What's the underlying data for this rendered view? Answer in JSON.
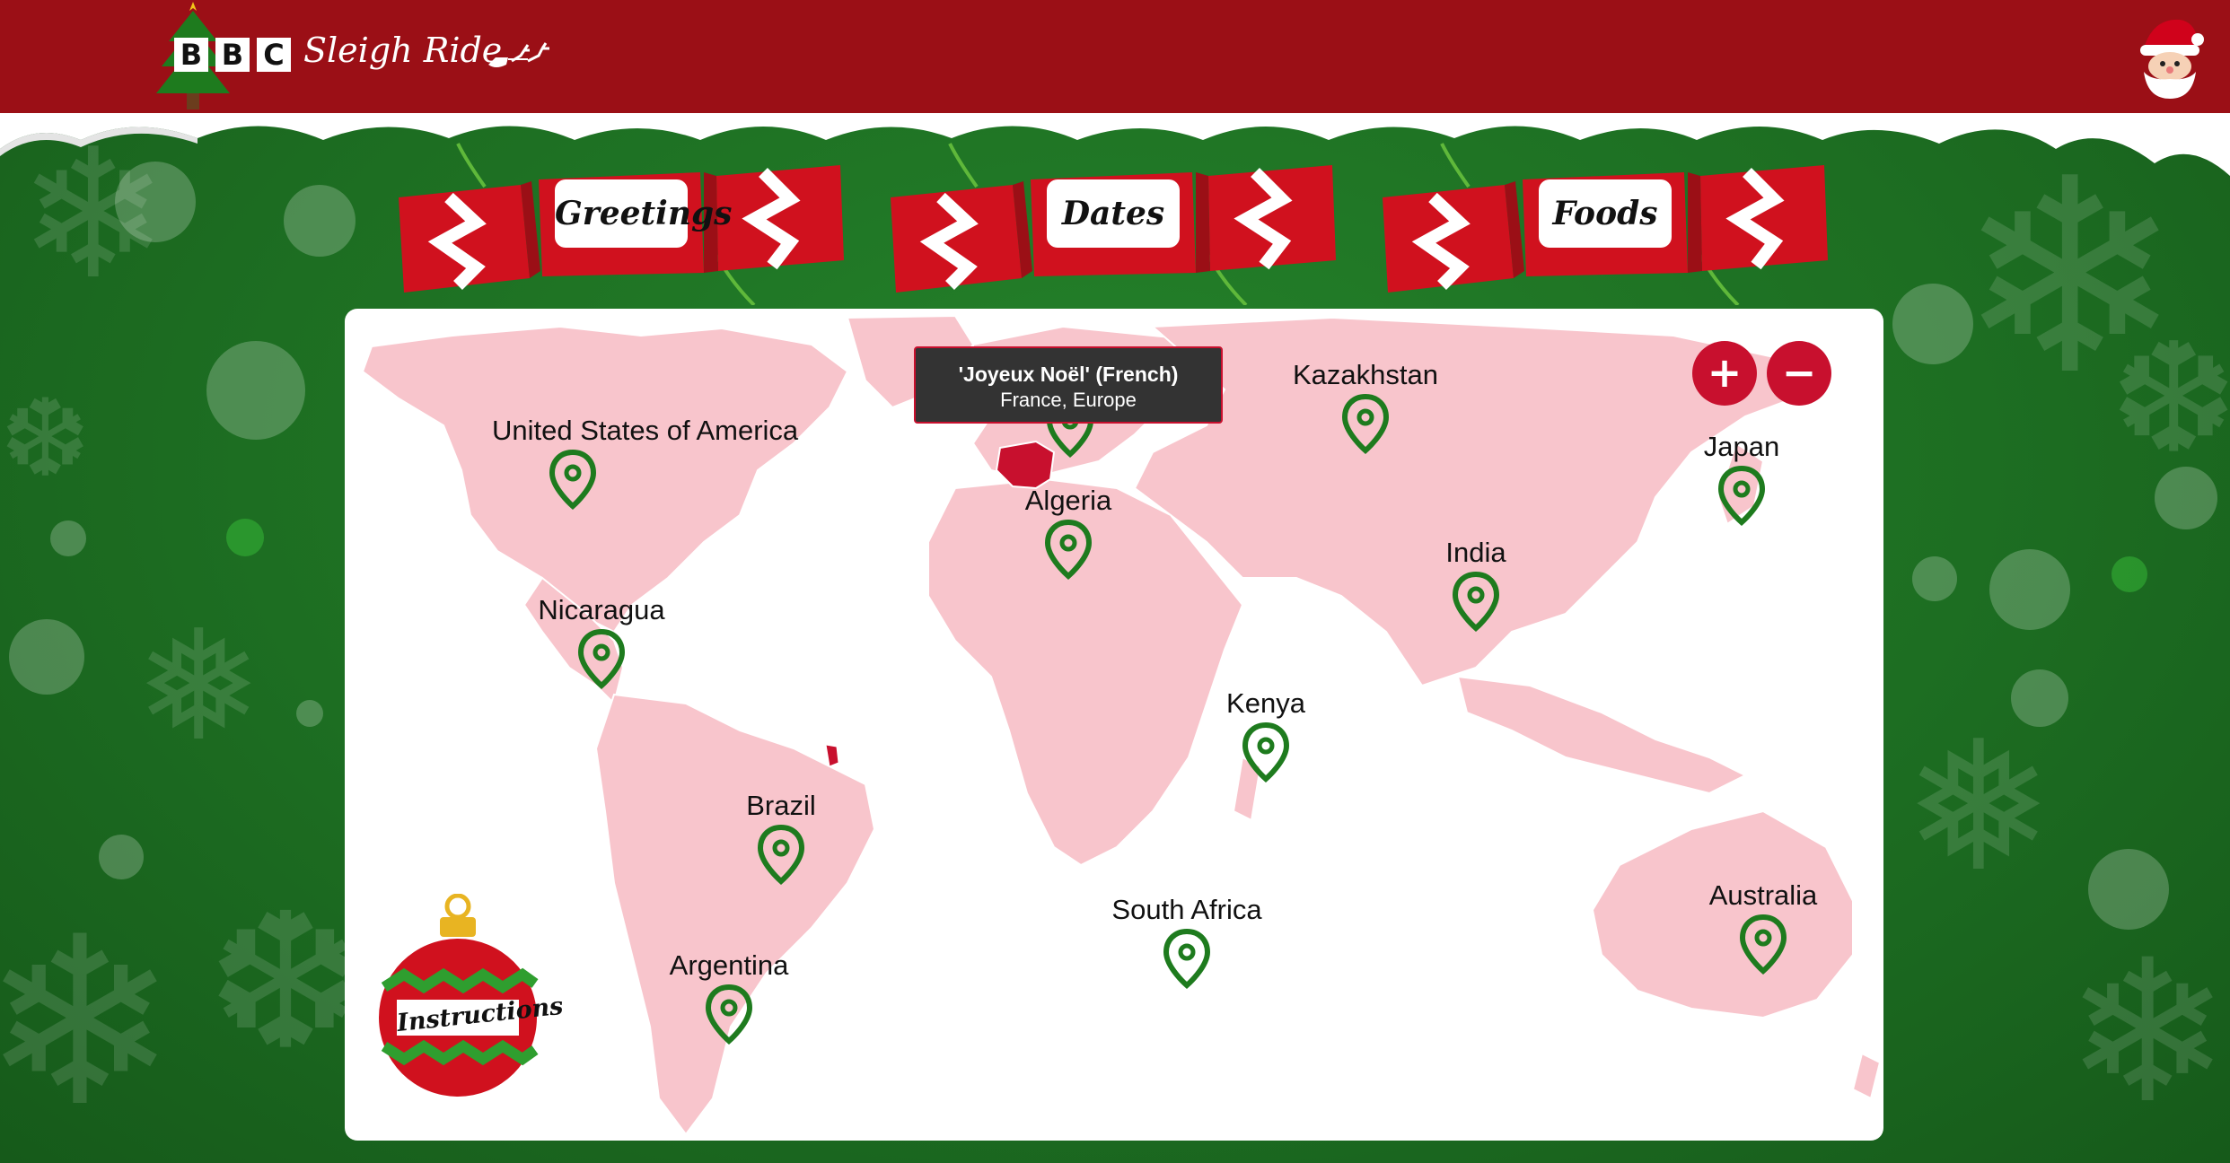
{
  "header": {
    "logo_letters": [
      "B",
      "B",
      "C"
    ],
    "app_name": "Sleigh Ride",
    "avatar_icon": "santa-icon"
  },
  "crackers": [
    {
      "label": "Greetings"
    },
    {
      "label": "Dates"
    },
    {
      "label": "Foods"
    }
  ],
  "map": {
    "tooltip": {
      "phrase": "'Joyeux Noël' (French)",
      "location": "France, Europe"
    },
    "zoom": {
      "in_label": "+",
      "out_label": "−"
    },
    "markers": [
      {
        "name": "United States of America"
      },
      {
        "name": "Kazakhstan"
      },
      {
        "name": "Japan"
      },
      {
        "name": "Algeria"
      },
      {
        "name": "India"
      },
      {
        "name": "Nicaragua"
      },
      {
        "name": "Kenya"
      },
      {
        "name": "Brazil"
      },
      {
        "name": "South Africa"
      },
      {
        "name": "Australia"
      },
      {
        "name": "Argentina"
      }
    ],
    "highlighted_countries": [
      "France",
      "French Guiana"
    ],
    "colors": {
      "land": "#f8c5cc",
      "highlight": "#c8102e",
      "marker": "#1e7b1e"
    }
  },
  "instructions": {
    "label": "Instructions"
  },
  "colors": {
    "header": "#9b0f16",
    "background": "#1d6e22",
    "accent": "#c8102e"
  }
}
